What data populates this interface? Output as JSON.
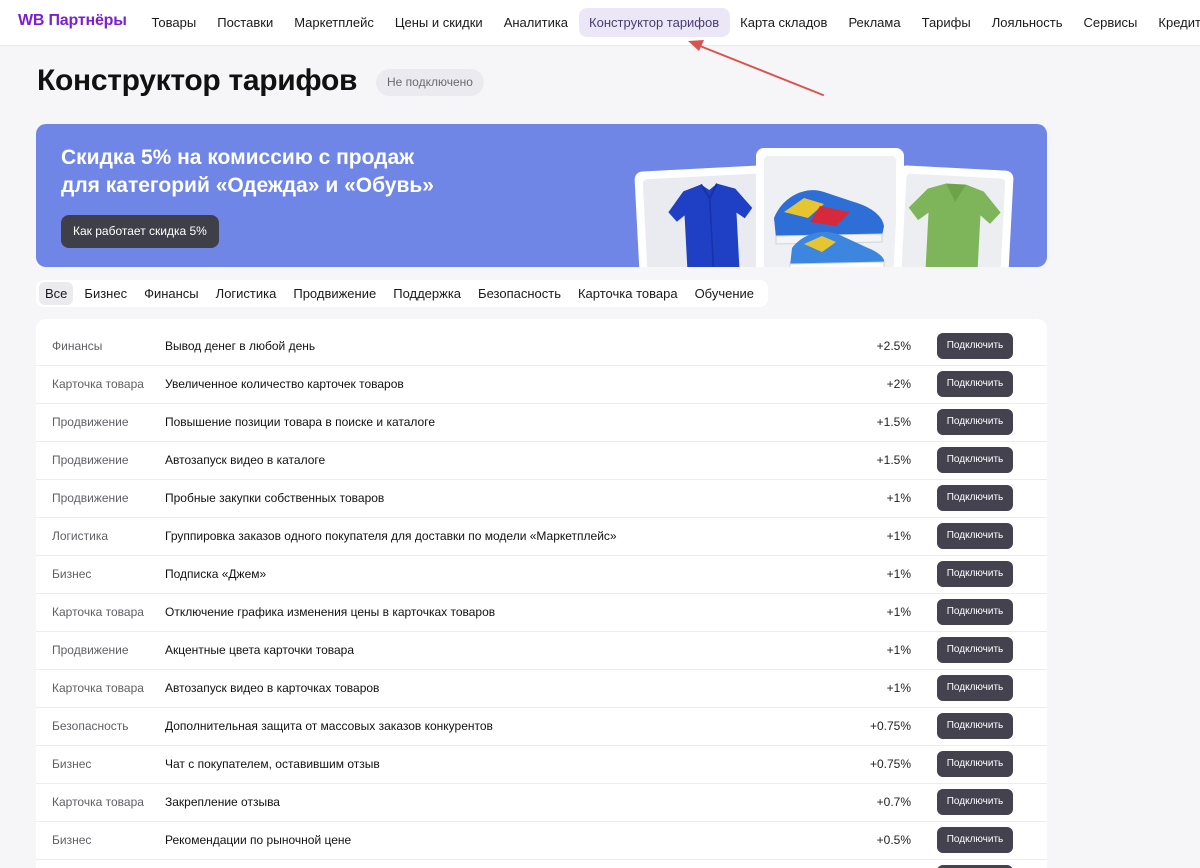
{
  "brand": {
    "logo": "WB Партнёры",
    "accent": "#7b1fd1"
  },
  "nav": [
    {
      "label": "Товары",
      "active": false
    },
    {
      "label": "Поставки",
      "active": false
    },
    {
      "label": "Маркетплейс",
      "active": false
    },
    {
      "label": "Цены и скидки",
      "active": false
    },
    {
      "label": "Аналитика",
      "active": false
    },
    {
      "label": "Конструктор тарифов",
      "active": true
    },
    {
      "label": "Карта складов",
      "active": false
    },
    {
      "label": "Реклама",
      "active": false
    },
    {
      "label": "Тарифы",
      "active": false
    },
    {
      "label": "Лояльность",
      "active": false
    },
    {
      "label": "Сервисы",
      "active": false
    },
    {
      "label": "Кредиты",
      "active": false
    }
  ],
  "page": {
    "title": "Конструктор тарифов",
    "status": "Не подключено"
  },
  "banner": {
    "title_line1": "Скидка 5% на комиссию с продаж",
    "title_line2": "для категорий «Одежда» и «Обувь»",
    "button": "Как работает скидка 5%",
    "bg_color": "#6f86e6",
    "images": [
      "blue-shirt-image",
      "sneakers-image",
      "green-polo-image"
    ]
  },
  "tabs": [
    {
      "label": "Все",
      "active": true
    },
    {
      "label": "Бизнес",
      "active": false
    },
    {
      "label": "Финансы",
      "active": false
    },
    {
      "label": "Логистика",
      "active": false
    },
    {
      "label": "Продвижение",
      "active": false
    },
    {
      "label": "Поддержка",
      "active": false
    },
    {
      "label": "Безопасность",
      "active": false
    },
    {
      "label": "Карточка товара",
      "active": false
    },
    {
      "label": "Обучение",
      "active": false
    }
  ],
  "rows": [
    {
      "category": "Финансы",
      "name": "Вывод денег в любой день",
      "percent": "+2.5%",
      "button": "Подключить"
    },
    {
      "category": "Карточка товара",
      "name": "Увеличенное количество карточек товаров",
      "percent": "+2%",
      "button": "Подключить"
    },
    {
      "category": "Продвижение",
      "name": "Повышение позиции товара в поиске и каталоге",
      "percent": "+1.5%",
      "button": "Подключить"
    },
    {
      "category": "Продвижение",
      "name": "Автозапуск видео в каталоге",
      "percent": "+1.5%",
      "button": "Подключить"
    },
    {
      "category": "Продвижение",
      "name": "Пробные закупки собственных товаров",
      "percent": "+1%",
      "button": "Подключить"
    },
    {
      "category": "Логистика",
      "name": "Группировка заказов одного покупателя для доставки по модели «Маркетплейс»",
      "percent": "+1%",
      "button": "Подключить"
    },
    {
      "category": "Бизнес",
      "name": "Подписка «Джем»",
      "percent": "+1%",
      "button": "Подключить"
    },
    {
      "category": "Карточка товара",
      "name": "Отключение графика изменения цены в карточках товаров",
      "percent": "+1%",
      "button": "Подключить"
    },
    {
      "category": "Продвижение",
      "name": "Акцентные цвета карточки товара",
      "percent": "+1%",
      "button": "Подключить"
    },
    {
      "category": "Карточка товара",
      "name": "Автозапуск видео в карточках товаров",
      "percent": "+1%",
      "button": "Подключить"
    },
    {
      "category": "Безопасность",
      "name": "Дополнительная защита от массовых заказов конкурентов",
      "percent": "+0.75%",
      "button": "Подключить"
    },
    {
      "category": "Бизнес",
      "name": "Чат с покупателем, оставившим отзыв",
      "percent": "+0.75%",
      "button": "Подключить"
    },
    {
      "category": "Карточка товара",
      "name": "Закрепление отзыва",
      "percent": "+0.7%",
      "button": "Подключить"
    },
    {
      "category": "Бизнес",
      "name": "Рекомендации по рыночной цене",
      "percent": "+0.5%",
      "button": "Подключить"
    },
    {
      "category": "",
      "name": "",
      "percent": "",
      "button": "Подключить"
    }
  ],
  "annotation": {
    "arrow_color": "#d9534f"
  }
}
